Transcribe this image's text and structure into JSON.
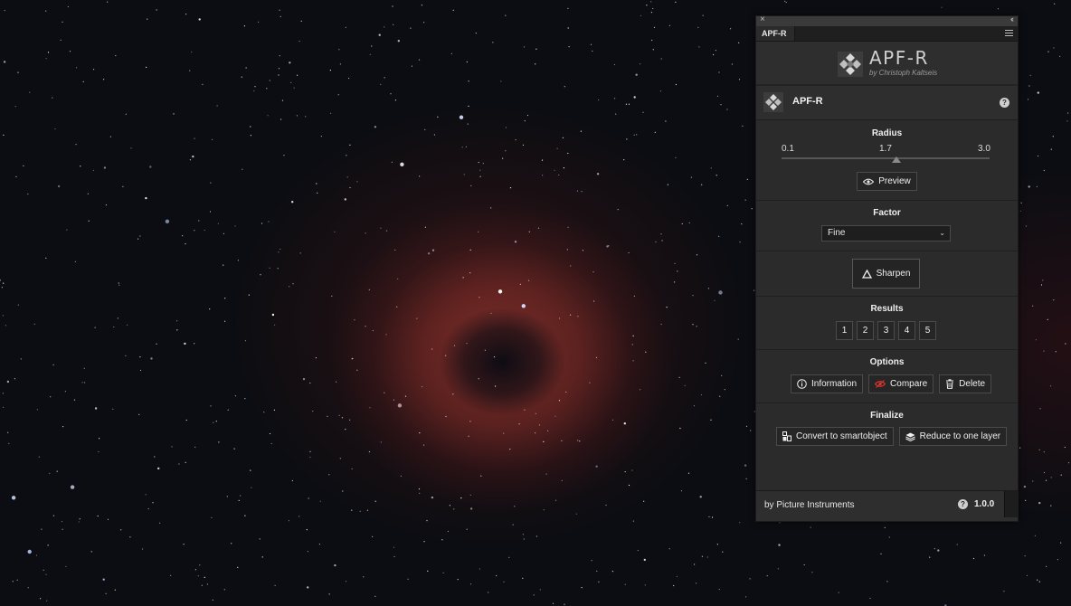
{
  "panel": {
    "tab_label": "APF-R",
    "close_glyph": "×",
    "collapse_glyph": "‹‹",
    "logo": {
      "title": "APF-R",
      "subtitle": "by Christoph Kaltseis"
    },
    "header": {
      "title": "APF-R",
      "help_glyph": "?"
    }
  },
  "radius": {
    "title": "Radius",
    "min_label": "0.1",
    "value_label": "1.7",
    "max_label": "3.0",
    "min": 0.1,
    "max": 3.0,
    "value": 1.7,
    "preview_label": "Preview"
  },
  "factor": {
    "title": "Factor",
    "selected": "Fine"
  },
  "sharpen": {
    "label": "Sharpen"
  },
  "results": {
    "title": "Results",
    "buttons": [
      "1",
      "2",
      "3",
      "4",
      "5"
    ]
  },
  "options": {
    "title": "Options",
    "information_label": "Information",
    "compare_label": "Compare",
    "delete_label": "Delete"
  },
  "finalize": {
    "title": "Finalize",
    "convert_label": "Convert to smartobject",
    "reduce_label": "Reduce to one layer"
  },
  "footer": {
    "credit": "by Picture Instruments",
    "help_glyph": "?",
    "version": "1.0.0"
  },
  "colors": {
    "panel_bg": "#2b2b2b",
    "compare_accent": "#e0342f",
    "nebula": "#a8403a"
  }
}
